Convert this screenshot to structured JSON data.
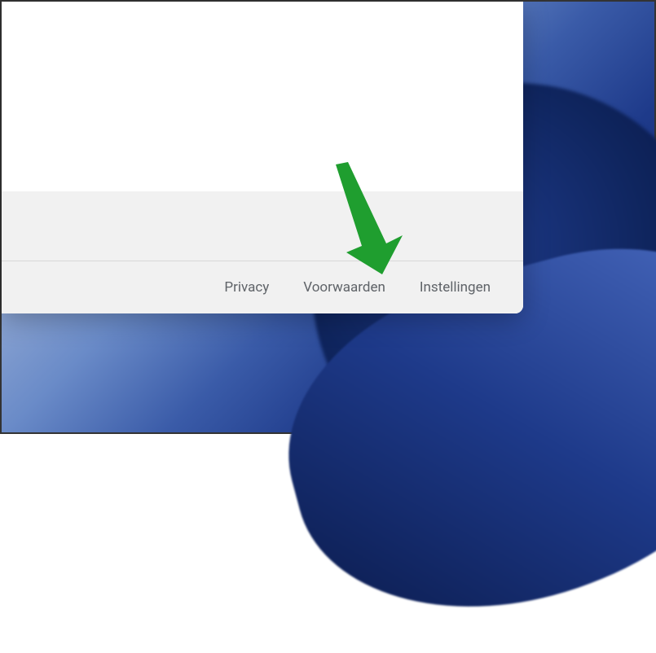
{
  "footer": {
    "links": [
      {
        "label": "Privacy"
      },
      {
        "label": "Voorwaarden"
      },
      {
        "label": "Instellingen"
      }
    ]
  },
  "annotation": {
    "arrow_color": "#1f9e2f"
  }
}
